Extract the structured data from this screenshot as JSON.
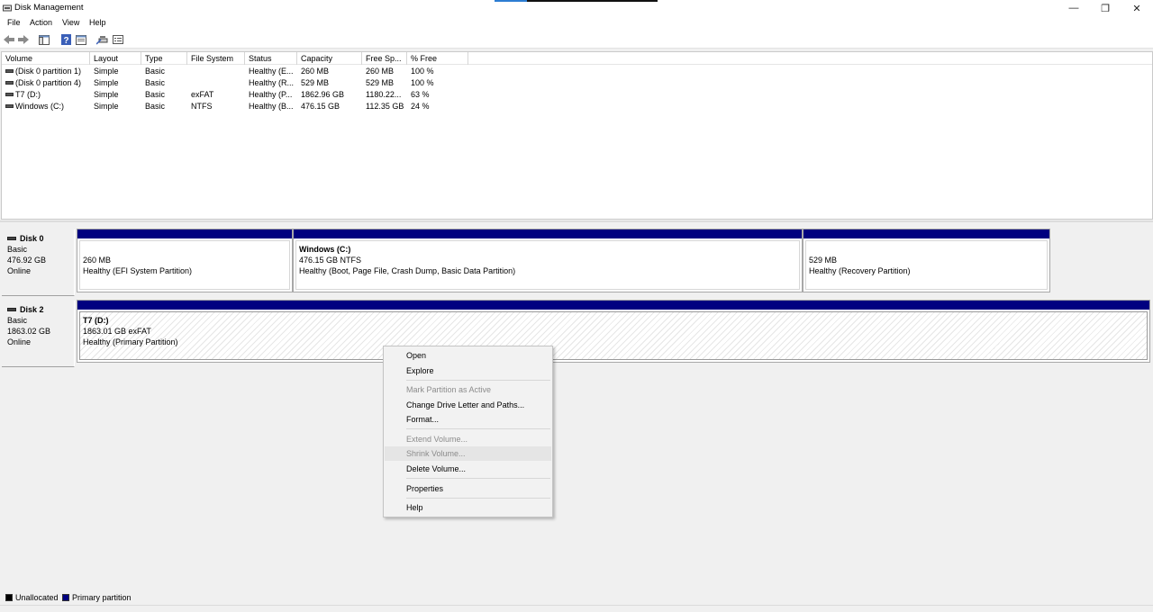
{
  "window": {
    "title": "Disk Management",
    "minimize": "—",
    "restore": "❐",
    "close": "✕"
  },
  "menu": [
    "File",
    "Action",
    "View",
    "Help"
  ],
  "toolbar": {
    "icons": [
      "back-icon",
      "forward-icon",
      "console-tree-icon",
      "help-icon",
      "properties-icon",
      "connect-icon",
      "details-icon"
    ]
  },
  "volume_list": {
    "columns": [
      "Volume",
      "Layout",
      "Type",
      "File System",
      "Status",
      "Capacity",
      "Free Sp...",
      "% Free"
    ],
    "rows": [
      {
        "volume": "(Disk 0 partition 1)",
        "layout": "Simple",
        "type": "Basic",
        "fs": "",
        "status": "Healthy (E...",
        "capacity": "260 MB",
        "free": "260 MB",
        "pct": "100 %"
      },
      {
        "volume": "(Disk 0 partition 4)",
        "layout": "Simple",
        "type": "Basic",
        "fs": "",
        "status": "Healthy (R...",
        "capacity": "529 MB",
        "free": "529 MB",
        "pct": "100 %"
      },
      {
        "volume": "T7 (D:)",
        "layout": "Simple",
        "type": "Basic",
        "fs": "exFAT",
        "status": "Healthy (P...",
        "capacity": "1862.96 GB",
        "free": "1180.22...",
        "pct": "63 %"
      },
      {
        "volume": "Windows (C:)",
        "layout": "Simple",
        "type": "Basic",
        "fs": "NTFS",
        "status": "Healthy (B...",
        "capacity": "476.15 GB",
        "free": "112.35 GB",
        "pct": "24 %"
      }
    ]
  },
  "disks": [
    {
      "name": "Disk 0",
      "type": "Basic",
      "size": "476.92 GB",
      "state": "Online",
      "partitions": [
        {
          "name": "",
          "size": "260 MB",
          "status": "Healthy (EFI System Partition)"
        },
        {
          "name": "Windows  (C:)",
          "size": "476.15 GB NTFS",
          "status": "Healthy (Boot, Page File, Crash Dump, Basic Data Partition)"
        },
        {
          "name": "",
          "size": "529 MB",
          "status": "Healthy (Recovery Partition)"
        }
      ]
    },
    {
      "name": "Disk 2",
      "type": "Basic",
      "size": "1863.02 GB",
      "state": "Online",
      "partitions": [
        {
          "name": "T7  (D:)",
          "size": "1863.01 GB exFAT",
          "status": "Healthy (Primary Partition)"
        }
      ]
    }
  ],
  "context_menu": {
    "items": [
      {
        "label": "Open",
        "enabled": true
      },
      {
        "label": "Explore",
        "enabled": true
      },
      {
        "label": "Mark Partition as Active",
        "enabled": false
      },
      {
        "label": "Change Drive Letter and Paths...",
        "enabled": true
      },
      {
        "label": "Format...",
        "enabled": true
      },
      {
        "label": "Extend Volume...",
        "enabled": false
      },
      {
        "label": "Shrink Volume...",
        "enabled": false,
        "highlighted": true
      },
      {
        "label": "Delete Volume...",
        "enabled": true
      },
      {
        "label": "Properties",
        "enabled": true
      },
      {
        "label": "Help",
        "enabled": true
      }
    ]
  },
  "legend": {
    "unallocated": "Unallocated",
    "primary": "Primary partition",
    "unallocated_color": "#000000",
    "primary_color": "#000080"
  }
}
